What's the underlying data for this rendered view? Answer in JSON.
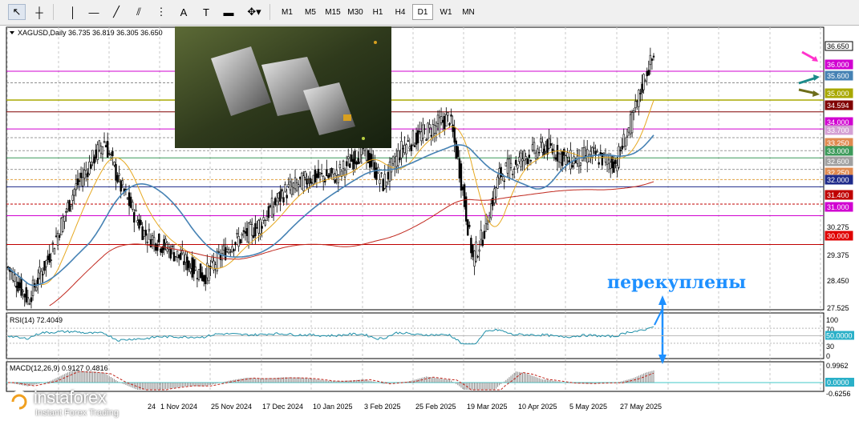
{
  "toolbar": {
    "tools": [
      {
        "name": "cursor-arrow-icon",
        "glyph": "↖",
        "selected": true
      },
      {
        "name": "crosshair-icon",
        "glyph": "┼",
        "selected": false
      },
      {
        "name": "vertical-line-icon",
        "glyph": "│",
        "selected": false
      },
      {
        "name": "horizontal-line-icon",
        "glyph": "—",
        "selected": false
      },
      {
        "name": "trendline-icon",
        "glyph": "╱",
        "selected": false
      },
      {
        "name": "channel-icon",
        "glyph": "⫽",
        "selected": false
      },
      {
        "name": "fibonacci-icon",
        "glyph": "⋮",
        "selected": false
      },
      {
        "name": "text-tool-icon",
        "glyph": "A",
        "selected": false
      },
      {
        "name": "label-tool-icon",
        "glyph": "T",
        "selected": false
      },
      {
        "name": "rectangle-tool-icon",
        "glyph": "▬",
        "selected": false
      },
      {
        "name": "shapes-menu-icon",
        "glyph": "✥▾",
        "selected": false
      }
    ],
    "timeframes": [
      "M1",
      "M5",
      "M15",
      "M30",
      "H1",
      "H4",
      "D1",
      "W1",
      "MN"
    ],
    "active_timeframe": "D1"
  },
  "chart": {
    "header": "XAGUSD,Daily  36.735 36.819 36.305 36.650",
    "caption": "перекуплены",
    "logo_brand": "instaforex",
    "logo_tagline": "Instant Forex Trading",
    "colors": {
      "magenta": "#d100d1",
      "olive": "#a8a800",
      "maroon": "#800000",
      "blue": "#1e90ff",
      "ma_fast": "#e6a820",
      "ma_mid": "#4682b4",
      "ma_slow": "#c0281e",
      "rsi": "#1e8fa8"
    }
  },
  "price_labels": [
    {
      "text": "36.650",
      "bg": "#ffffff",
      "fg": "#000000",
      "border": "#000000"
    },
    {
      "text": "36.000",
      "bg": "#d100d1",
      "fg": "#ffffff"
    },
    {
      "text": "35.600",
      "bg": "#4682b4",
      "fg": "#ffffff"
    },
    {
      "text": "35.000",
      "bg": "#a8a800",
      "fg": "#ffffff"
    },
    {
      "text": "34.594",
      "bg": "#800000",
      "fg": "#ffffff"
    },
    {
      "text": "34.000",
      "bg": "#d100d1",
      "fg": "#ffffff"
    },
    {
      "text": "33.700",
      "bg": "#d4a0d4",
      "fg": "#ffffff"
    },
    {
      "text": "33.250",
      "bg": "#e08a50",
      "fg": "#ffffff"
    },
    {
      "text": "33.000",
      "bg": "#3c9a5a",
      "fg": "#ffffff"
    },
    {
      "text": "32.600",
      "bg": "#a0a0a0",
      "fg": "#ffffff"
    },
    {
      "text": "32.250",
      "bg": "#e08a50",
      "fg": "#ffffff"
    },
    {
      "text": "32.000",
      "bg": "#1e2a8a",
      "fg": "#ffffff"
    },
    {
      "text": "31.400",
      "bg": "#c00000",
      "fg": "#ffffff"
    },
    {
      "text": "31.000",
      "bg": "#d100d1",
      "fg": "#ffffff"
    },
    {
      "text": "30.275",
      "bg": "",
      "fg": "#000000"
    },
    {
      "text": "30.000",
      "bg": "#e00000",
      "fg": "#ffffff"
    },
    {
      "text": "29.375",
      "bg": "",
      "fg": "#000000"
    },
    {
      "text": "28.450",
      "bg": "",
      "fg": "#000000"
    },
    {
      "text": "27.525",
      "bg": "",
      "fg": "#000000"
    }
  ],
  "rsi": {
    "label": "RSI(14) 72.4049",
    "scale": [
      "100",
      "70",
      "30",
      "0"
    ],
    "current_label": "50.0000"
  },
  "macd": {
    "label": "MACD(12,26,9) 0.9127 0.4816",
    "scale_top": "0.9962",
    "scale_bottom": "-0.6256",
    "current_label": "0.0000"
  },
  "x_axis": {
    "labels": [
      "1 Nov 2024",
      "25 Nov 2024",
      "17 Dec 2024",
      "10 Jan 2025",
      "3 Feb 2025",
      "25 Feb 2025",
      "19 Mar 2025",
      "10 Apr 2025",
      "5 May 2025",
      "27 May 2025"
    ],
    "partial_left_label": "24"
  }
}
